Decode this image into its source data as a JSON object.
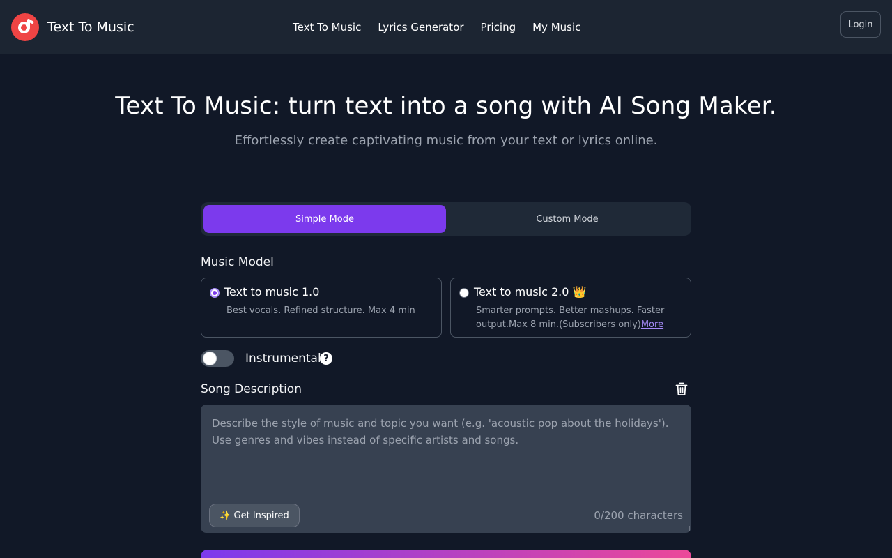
{
  "brand": {
    "name": "Text To Music"
  },
  "nav": {
    "items": [
      "Text To Music",
      "Lyrics Generator",
      "Pricing",
      "My Music"
    ],
    "login_label": "Login"
  },
  "hero": {
    "title": "Text To Music: turn text into a song with AI Song Maker.",
    "subtitle": "Effortlessly create captivating music from your text or lyrics online."
  },
  "modes": {
    "tabs": [
      "Simple Mode",
      "Custom Mode"
    ],
    "active": "Simple Mode"
  },
  "music_model": {
    "label": "Music Model",
    "options": [
      {
        "title": "Text to music 1.0",
        "description": "Best vocals. Refined structure. Max 4 min",
        "selected": true
      },
      {
        "title": "Text to music 2.0 👑",
        "description": "Smarter prompts. Better mashups. Faster output.Max 8 min.(Subscribers only)",
        "link": "More",
        "selected": false
      }
    ]
  },
  "instrumental": {
    "label": "Instrumental",
    "enabled": false
  },
  "song_description": {
    "label": "Song Description",
    "placeholder": "Describe the style of music and topic you want (e.g. 'acoustic pop about the holidays'). Use genres and vibes instead of specific artists and songs.",
    "value": "",
    "inspire_label": "✨ Get Inspired",
    "char_count": "0/200 characters"
  },
  "colors": {
    "background": "#111827",
    "header": "#1c2532",
    "accent": "#7c3aed",
    "accent_end": "#ec4899",
    "logo": "#ef4444"
  }
}
